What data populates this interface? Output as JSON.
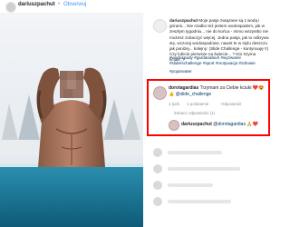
{
  "header": {
    "owner": "dariuszpachut",
    "separator": "•",
    "follow_label": "Obserwuj"
  },
  "caption": {
    "author": "dariuszpachut",
    "text": "Moje pasje związane są z wodą i górami... Nie rzadko też jestem wodospadem, jak w zeszłym tygodniu... nie do końca - mimo wszystko nie możesz zobaczyć więcej. Jedna pasja, jak to odkrywa się, wczoraj wodospadowe, nawet te w stylu deszczu jak poniżej... kolejny: (Slide Challenge - kontynuuję !!) Czy lubicie pierwsze na świecie... ? Kto trzyma kciuki..?",
    "hashtags": "#wodospady #gardanabiuh #wyzwanie #sliderschallenge #sport #motywacja #zdrowie",
    "tag2": "#pojazwater"
  },
  "comment_highlight": {
    "author": "dorotagardias",
    "text": "Trzymam za Ciebie kciuki ❤️😍👍",
    "mention": "@slide_challenge",
    "time": "1 tydz.",
    "likes": "1 polubienie",
    "reply": "Odpowiedz",
    "view_replies": "Zobacz odpowiedzi (1)",
    "reply_author": "dariuszpachut",
    "reply_text": "@dorotagardias 🙏❤️"
  },
  "colors": {
    "highlight_border": "#ff0000",
    "link": "#003569",
    "accent": "#3897f0"
  },
  "icons": {
    "heart": "heart-icon",
    "avatar": "avatar"
  }
}
